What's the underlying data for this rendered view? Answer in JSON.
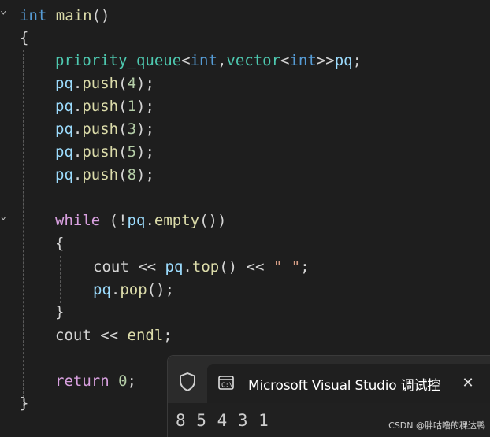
{
  "code": {
    "line1": {
      "t1": "int",
      "t2": " main",
      "t3": "()"
    },
    "brace_open": "{",
    "line3": {
      "t1": "priority_queue",
      "t2": "<",
      "t3": "int",
      "t4": ",",
      "t5": "vector",
      "t6": "<",
      "t7": "int",
      "t8": ">>",
      "t9": "pq",
      "t10": ";"
    },
    "push_calls": [
      {
        "obj": "pq",
        "dot": ".",
        "fn": "push",
        "open": "(",
        "arg": "4",
        "close": ")",
        "semi": ";"
      },
      {
        "obj": "pq",
        "dot": ".",
        "fn": "push",
        "open": "(",
        "arg": "1",
        "close": ")",
        "semi": ";"
      },
      {
        "obj": "pq",
        "dot": ".",
        "fn": "push",
        "open": "(",
        "arg": "3",
        "close": ")",
        "semi": ";"
      },
      {
        "obj": "pq",
        "dot": ".",
        "fn": "push",
        "open": "(",
        "arg": "5",
        "close": ")",
        "semi": ";"
      },
      {
        "obj": "pq",
        "dot": ".",
        "fn": "push",
        "open": "(",
        "arg": "8",
        "close": ")",
        "semi": ";"
      }
    ],
    "while_line": {
      "kw": "while",
      "sp": " (",
      "not": "!",
      "obj": "pq",
      "dot": ".",
      "fn": "empty",
      "args": "()",
      "close": ")"
    },
    "inner_open": "{",
    "cout_line": {
      "kw": "cout",
      "op1": " << ",
      "obj": "pq",
      "dot": ".",
      "fn": "top",
      "args": "()",
      "op2": " << ",
      "str": "\" \"",
      "semi": ";"
    },
    "pop_line": {
      "obj": "pq",
      "dot": ".",
      "fn": "pop",
      "args": "()",
      "semi": ";"
    },
    "inner_close": "}",
    "endl_line": {
      "kw": "cout",
      "op": " << ",
      "fn": "endl",
      "semi": ";"
    },
    "return_line": {
      "kw": "return",
      "sp": " ",
      "num": "0",
      "semi": ";"
    },
    "brace_close": "}"
  },
  "fold_markers": {
    "main": "⌄",
    "while": "⌄"
  },
  "console": {
    "title": "Microsoft Visual Studio 调试控",
    "output": "8 5 4 3 1",
    "shield_icon": "shield-icon",
    "console_icon": "console-icon",
    "close_icon": "close-icon"
  },
  "watermark": "CSDN @胖咕噜的稞达鸭",
  "colors": {
    "keyword": "#569cd6",
    "control": "#d8a0df",
    "function": "#dcdcaa",
    "variable": "#9cdcfe",
    "number": "#b5cea8",
    "string": "#d69d85"
  }
}
